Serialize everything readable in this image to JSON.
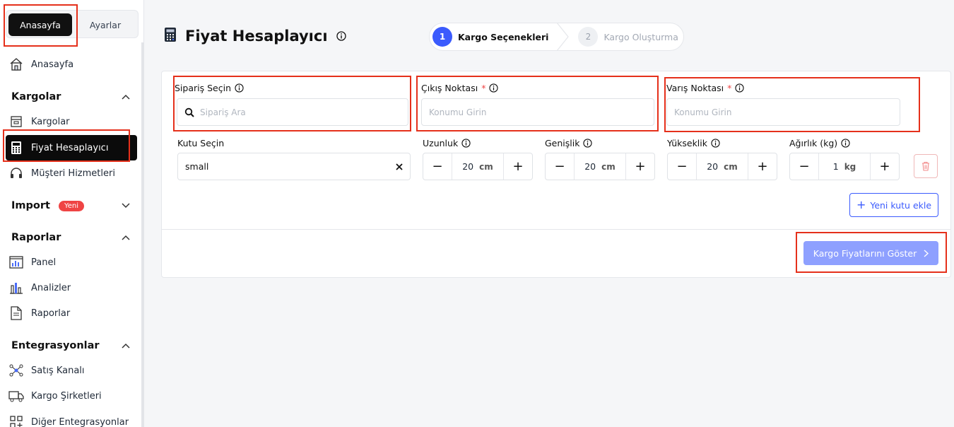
{
  "sidebar": {
    "tabs": {
      "home": "Anasayfa",
      "settings": "Ayarlar"
    },
    "home_item": "Anasayfa",
    "sections": {
      "kargolar": "Kargolar",
      "import": "Import",
      "import_badge": "Yeni",
      "raporlar": "Raporlar",
      "entegrasyonlar": "Entegrasyonlar"
    },
    "items": {
      "kargolar": "Kargolar",
      "fiyat": "Fiyat Hesaplayıcı",
      "musteri": "Müşteri Hizmetleri",
      "panel": "Panel",
      "analizler": "Analizler",
      "raporlar": "Raporlar",
      "satis": "Satış Kanalı",
      "kargo_sirketleri": "Kargo Şirketleri",
      "diger": "Diğer Entegrasyonlar"
    }
  },
  "header": {
    "title": "Fiyat Hesaplayıcı"
  },
  "stepper": {
    "steps": [
      {
        "num": "1",
        "label": "Kargo Seçenekleri"
      },
      {
        "num": "2",
        "label": "Kargo Oluşturma"
      }
    ]
  },
  "form": {
    "order": {
      "label": "Sipariş Seçin",
      "placeholder": "Sipariş Ara"
    },
    "origin": {
      "label": "Çıkış Noktası",
      "required": "*",
      "placeholder": "Konumu Girin"
    },
    "destination": {
      "label": "Varış Noktası",
      "required": "*",
      "placeholder": "Konumu Girin"
    },
    "box": {
      "label": "Kutu Seçin",
      "value": "small"
    },
    "length": {
      "label": "Uzunluk",
      "value": "20",
      "unit": "cm"
    },
    "width": {
      "label": "Genişlik",
      "value": "20",
      "unit": "cm"
    },
    "height": {
      "label": "Yükseklik",
      "value": "20",
      "unit": "cm"
    },
    "weight": {
      "label": "Ağırlık (kg)",
      "value": "1",
      "unit": "kg"
    },
    "add_box": "Yeni kutu ekle",
    "submit": "Kargo Fiyatlarını Göster"
  },
  "colors": {
    "accent": "#3b5bfd",
    "primary_disabled": "#8ea0ff",
    "danger": "#ef4444",
    "highlight": "#e5301b"
  }
}
